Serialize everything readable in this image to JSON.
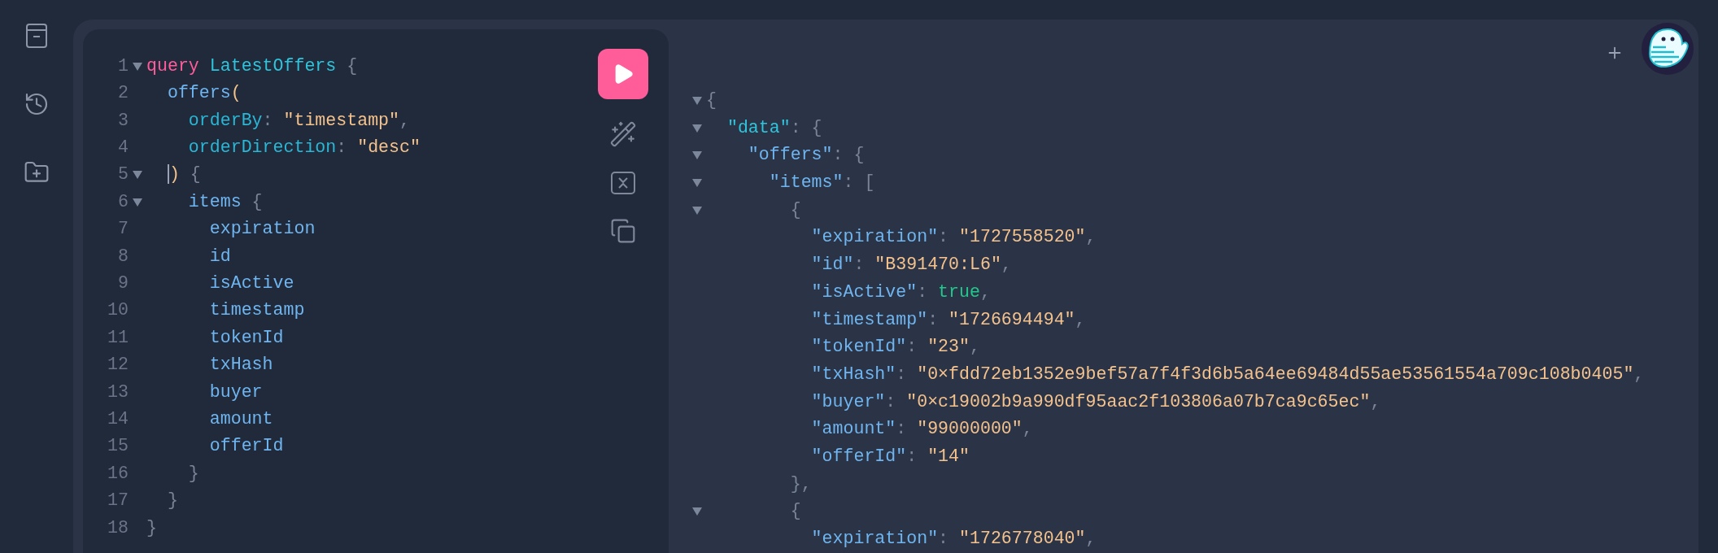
{
  "editor": {
    "lines": [
      {
        "number": "1",
        "foldable": true,
        "cursor": false,
        "tokens": [
          {
            "kind": "keyword",
            "text": "query"
          },
          {
            "kind": "name",
            "text": " LatestOffers"
          },
          {
            "kind": "punct",
            "text": " {"
          }
        ]
      },
      {
        "number": "2",
        "foldable": false,
        "cursor": false,
        "tokens": [
          {
            "kind": "field",
            "text": "  offers"
          },
          {
            "kind": "paren",
            "text": "("
          }
        ]
      },
      {
        "number": "3",
        "foldable": false,
        "cursor": false,
        "tokens": [
          {
            "kind": "arg",
            "text": "    orderBy"
          },
          {
            "kind": "punct",
            "text": ": "
          },
          {
            "kind": "string",
            "text": "\"timestamp\""
          },
          {
            "kind": "punct",
            "text": ","
          }
        ]
      },
      {
        "number": "4",
        "foldable": false,
        "cursor": false,
        "tokens": [
          {
            "kind": "arg",
            "text": "    orderDirection"
          },
          {
            "kind": "punct",
            "text": ": "
          },
          {
            "kind": "string",
            "text": "\"desc\""
          }
        ]
      },
      {
        "number": "5",
        "foldable": true,
        "cursor": true,
        "tokens": [
          {
            "kind": "paren",
            "text": "  )"
          },
          {
            "kind": "punct",
            "text": " {"
          }
        ]
      },
      {
        "number": "6",
        "foldable": true,
        "cursor": false,
        "tokens": [
          {
            "kind": "field",
            "text": "    items"
          },
          {
            "kind": "punct",
            "text": " {"
          }
        ]
      },
      {
        "number": "7",
        "foldable": false,
        "cursor": false,
        "tokens": [
          {
            "kind": "field",
            "text": "      expiration"
          }
        ]
      },
      {
        "number": "8",
        "foldable": false,
        "cursor": false,
        "tokens": [
          {
            "kind": "field",
            "text": "      id"
          }
        ]
      },
      {
        "number": "9",
        "foldable": false,
        "cursor": false,
        "tokens": [
          {
            "kind": "field",
            "text": "      isActive"
          }
        ]
      },
      {
        "number": "10",
        "foldable": false,
        "cursor": false,
        "tokens": [
          {
            "kind": "field",
            "text": "      timestamp"
          }
        ]
      },
      {
        "number": "11",
        "foldable": false,
        "cursor": false,
        "tokens": [
          {
            "kind": "field",
            "text": "      tokenId"
          }
        ]
      },
      {
        "number": "12",
        "foldable": false,
        "cursor": false,
        "tokens": [
          {
            "kind": "field",
            "text": "      txHash"
          }
        ]
      },
      {
        "number": "13",
        "foldable": false,
        "cursor": false,
        "tokens": [
          {
            "kind": "field",
            "text": "      buyer"
          }
        ]
      },
      {
        "number": "14",
        "foldable": false,
        "cursor": false,
        "tokens": [
          {
            "kind": "field",
            "text": "      amount"
          }
        ]
      },
      {
        "number": "15",
        "foldable": false,
        "cursor": false,
        "tokens": [
          {
            "kind": "field",
            "text": "      offerId"
          }
        ]
      },
      {
        "number": "16",
        "foldable": false,
        "cursor": false,
        "tokens": [
          {
            "kind": "punct",
            "text": "    }"
          }
        ]
      },
      {
        "number": "17",
        "foldable": false,
        "cursor": false,
        "tokens": [
          {
            "kind": "punct",
            "text": "  }"
          }
        ]
      },
      {
        "number": "18",
        "foldable": false,
        "cursor": false,
        "tokens": [
          {
            "kind": "punct",
            "text": "}"
          }
        ]
      }
    ]
  },
  "result": {
    "lines": [
      {
        "foldable": true,
        "tokens": [
          {
            "kind": "punct",
            "text": "{"
          }
        ]
      },
      {
        "foldable": true,
        "tokens": [
          {
            "kind": "rootkey",
            "text": "  \"data\""
          },
          {
            "kind": "punct",
            "text": ": {"
          }
        ]
      },
      {
        "foldable": true,
        "tokens": [
          {
            "kind": "key",
            "text": "    \"offers\""
          },
          {
            "kind": "punct",
            "text": ": {"
          }
        ]
      },
      {
        "foldable": true,
        "tokens": [
          {
            "kind": "key",
            "text": "      \"items\""
          },
          {
            "kind": "punct",
            "text": ": ["
          }
        ]
      },
      {
        "foldable": true,
        "tokens": [
          {
            "kind": "punct",
            "text": "        {"
          }
        ]
      },
      {
        "foldable": false,
        "tokens": [
          {
            "kind": "key",
            "text": "          \"expiration\""
          },
          {
            "kind": "punct",
            "text": ": "
          },
          {
            "kind": "string",
            "text": "\"1727558520\""
          },
          {
            "kind": "punct",
            "text": ","
          }
        ]
      },
      {
        "foldable": false,
        "tokens": [
          {
            "kind": "key",
            "text": "          \"id\""
          },
          {
            "kind": "punct",
            "text": ": "
          },
          {
            "kind": "string",
            "text": "\"B391470:L6\""
          },
          {
            "kind": "punct",
            "text": ","
          }
        ]
      },
      {
        "foldable": false,
        "tokens": [
          {
            "kind": "key",
            "text": "          \"isActive\""
          },
          {
            "kind": "punct",
            "text": ": "
          },
          {
            "kind": "boolean",
            "text": "true"
          },
          {
            "kind": "punct",
            "text": ","
          }
        ]
      },
      {
        "foldable": false,
        "tokens": [
          {
            "kind": "key",
            "text": "          \"timestamp\""
          },
          {
            "kind": "punct",
            "text": ": "
          },
          {
            "kind": "string",
            "text": "\"1726694494\""
          },
          {
            "kind": "punct",
            "text": ","
          }
        ]
      },
      {
        "foldable": false,
        "tokens": [
          {
            "kind": "key",
            "text": "          \"tokenId\""
          },
          {
            "kind": "punct",
            "text": ": "
          },
          {
            "kind": "string",
            "text": "\"23\""
          },
          {
            "kind": "punct",
            "text": ","
          }
        ]
      },
      {
        "foldable": false,
        "tokens": [
          {
            "kind": "key",
            "text": "          \"txHash\""
          },
          {
            "kind": "punct",
            "text": ": "
          },
          {
            "kind": "string",
            "text": "\"0×fdd72eb1352e9bef57a7f4f3d6b5a64ee69484d55ae53561554a709c108b0405\""
          },
          {
            "kind": "punct",
            "text": ","
          }
        ]
      },
      {
        "foldable": false,
        "tokens": [
          {
            "kind": "key",
            "text": "          \"buyer\""
          },
          {
            "kind": "punct",
            "text": ": "
          },
          {
            "kind": "string",
            "text": "\"0×c19002b9a990df95aac2f103806a07b7ca9c65ec\""
          },
          {
            "kind": "punct",
            "text": ","
          }
        ]
      },
      {
        "foldable": false,
        "tokens": [
          {
            "kind": "key",
            "text": "          \"amount\""
          },
          {
            "kind": "punct",
            "text": ": "
          },
          {
            "kind": "string",
            "text": "\"99000000\""
          },
          {
            "kind": "punct",
            "text": ","
          }
        ]
      },
      {
        "foldable": false,
        "tokens": [
          {
            "kind": "key",
            "text": "          \"offerId\""
          },
          {
            "kind": "punct",
            "text": ": "
          },
          {
            "kind": "string",
            "text": "\"14\""
          }
        ]
      },
      {
        "foldable": false,
        "tokens": [
          {
            "kind": "punct",
            "text": "        },"
          }
        ]
      },
      {
        "foldable": true,
        "tokens": [
          {
            "kind": "punct",
            "text": "        {"
          }
        ]
      },
      {
        "foldable": false,
        "tokens": [
          {
            "kind": "key",
            "text": "          \"expiration\""
          },
          {
            "kind": "punct",
            "text": ": "
          },
          {
            "kind": "string",
            "text": "\"1726778040\""
          },
          {
            "kind": "punct",
            "text": ","
          }
        ]
      }
    ]
  }
}
